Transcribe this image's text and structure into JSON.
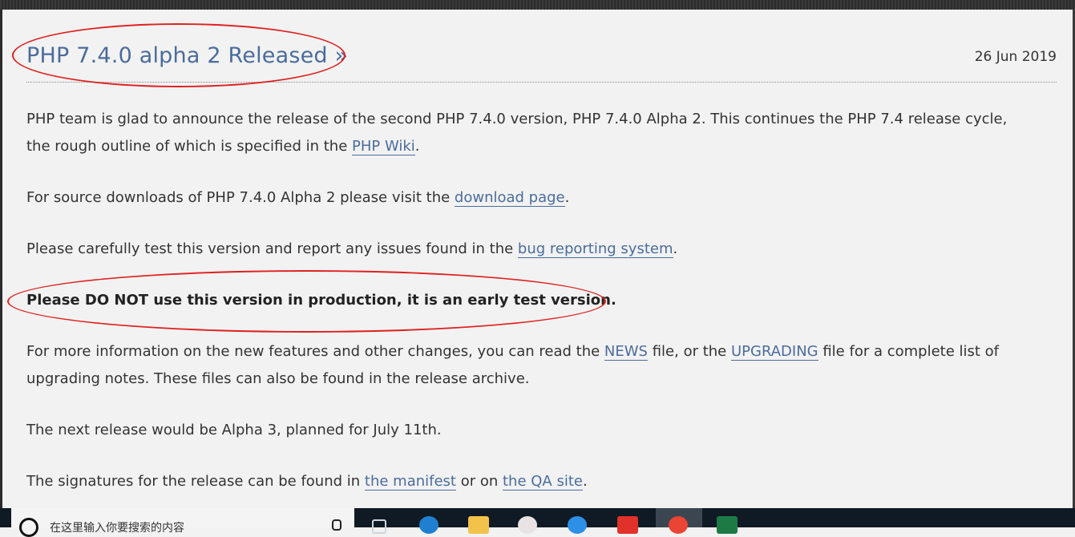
{
  "article": {
    "title": "PHP 7.4.0 alpha 2 Released »",
    "date": "26 Jun 2019",
    "p1_before": "PHP team is glad to announce the release of the second PHP 7.4.0 version, PHP 7.4.0 Alpha 2. This continues the PHP 7.4 release cycle, the rough outline of which is specified in the ",
    "p1_link": "PHP Wiki",
    "p1_after": ".",
    "p2_before": "For source downloads of PHP 7.4.0 Alpha 2 please visit the ",
    "p2_link": "download page",
    "p2_after": ".",
    "p3_before": "Please carefully test this version and report any issues found in the ",
    "p3_link": "bug reporting system",
    "p3_after": ".",
    "warning": "Please DO NOT use this version in production, it is an early test version.",
    "p5_before": "For more information on the new features and other changes, you can read the ",
    "p5_link1": "NEWS",
    "p5_mid": " file, or the ",
    "p5_link2": "UPGRADING",
    "p5_after": " file for a complete list of upgrading notes. These files can also be found in the release archive.",
    "p6": "The next release would be Alpha 3, planned for July 11th.",
    "p7_before": "The signatures for the release can be found in ",
    "p7_link1": "the manifest",
    "p7_mid": " or on ",
    "p7_link2": "the QA site",
    "p7_after": "."
  },
  "taskbar": {
    "search_text": "在这里输入你要搜索的内容",
    "icons": [
      "search-icon",
      "task-view-icon",
      "edge-icon",
      "file-explorer-icon",
      "app-icon",
      "app-icon-blue",
      "app-icon-red",
      "chrome-icon",
      "excel-icon"
    ]
  },
  "colors": {
    "link": "#4b6c9c",
    "annotation": "#e02020",
    "background": "#f2f2f2"
  }
}
